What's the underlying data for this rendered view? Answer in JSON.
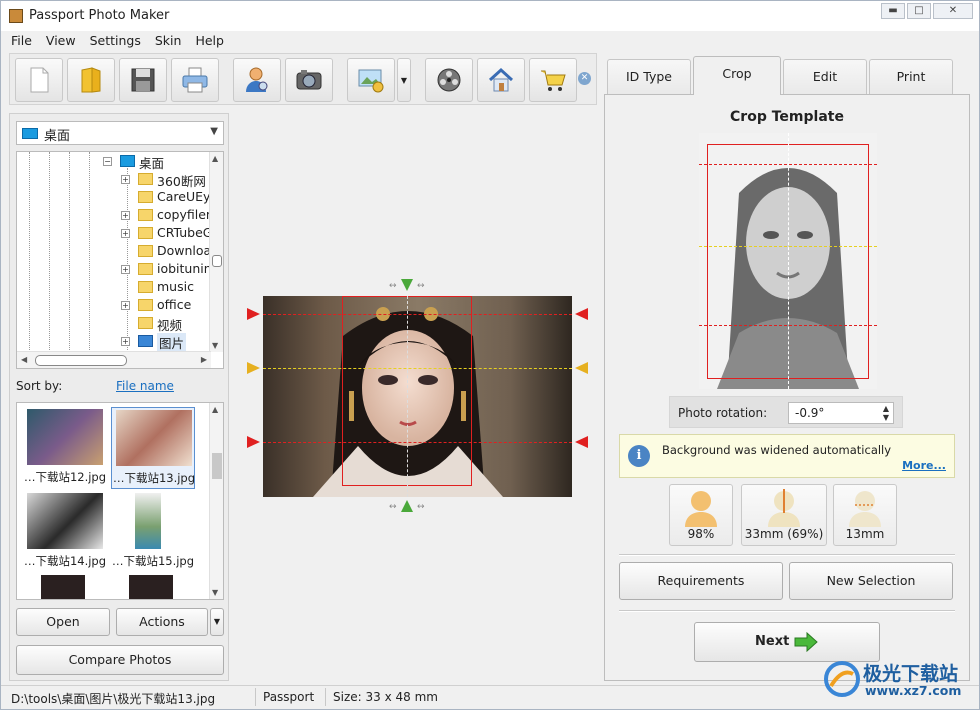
{
  "window": {
    "title": "Passport Photo Maker"
  },
  "menu": [
    "File",
    "View",
    "Settings",
    "Skin",
    "Help"
  ],
  "toolbar": {
    "icons": [
      "new-document-icon",
      "open-folder-icon",
      "save-icon",
      "print-icon",
      "person-search-icon",
      "camera-icon",
      "image-settings-icon",
      "film-reel-icon",
      "home-icon",
      "shopping-cart-icon"
    ]
  },
  "left": {
    "folder_select": "桌面",
    "tree": [
      {
        "label": "桌面",
        "expanded": true
      },
      {
        "label": "360断网"
      },
      {
        "label": "CareUEye"
      },
      {
        "label": "copyfilen"
      },
      {
        "label": "CRTubeG"
      },
      {
        "label": "Downloa"
      },
      {
        "label": "iobitunins"
      },
      {
        "label": "music"
      },
      {
        "label": "office"
      },
      {
        "label": "视频"
      },
      {
        "label": "图片"
      }
    ],
    "sort_by_label": "Sort by:",
    "sort_by_value": "File name",
    "thumbnails": [
      "…下载站12.jpg",
      "…下载站13.jpg",
      "…下载站14.jpg",
      "…下载站15.jpg"
    ],
    "open_button": "Open",
    "actions_button": "Actions",
    "compare_button": "Compare Photos"
  },
  "right": {
    "tabs": [
      "ID Type",
      "Crop",
      "Edit",
      "Print"
    ],
    "active_tab": "Crop",
    "crop_title": "Crop Template",
    "rotation_label": "Photo rotation:",
    "rotation_value": "-0.9°",
    "info_text": "Background was widened automatically",
    "info_more": "More...",
    "metrics": [
      "98%",
      "33mm (69%)",
      "13mm"
    ],
    "requirements_button": "Requirements",
    "new_selection_button": "New Selection",
    "next_button": "Next"
  },
  "status": {
    "path": "D:\\tools\\桌面\\图片\\极光下载站13.jpg",
    "type": "Passport",
    "size": "Size: 33 x 48 mm"
  },
  "watermark": {
    "name": "极光下载站",
    "url": "www.xz7.com"
  },
  "colors": {
    "guide_red": "#d42a2a",
    "guide_yellow": "#e6c21e",
    "guide_green": "#4aa83a",
    "link": "#1a6fc0"
  }
}
